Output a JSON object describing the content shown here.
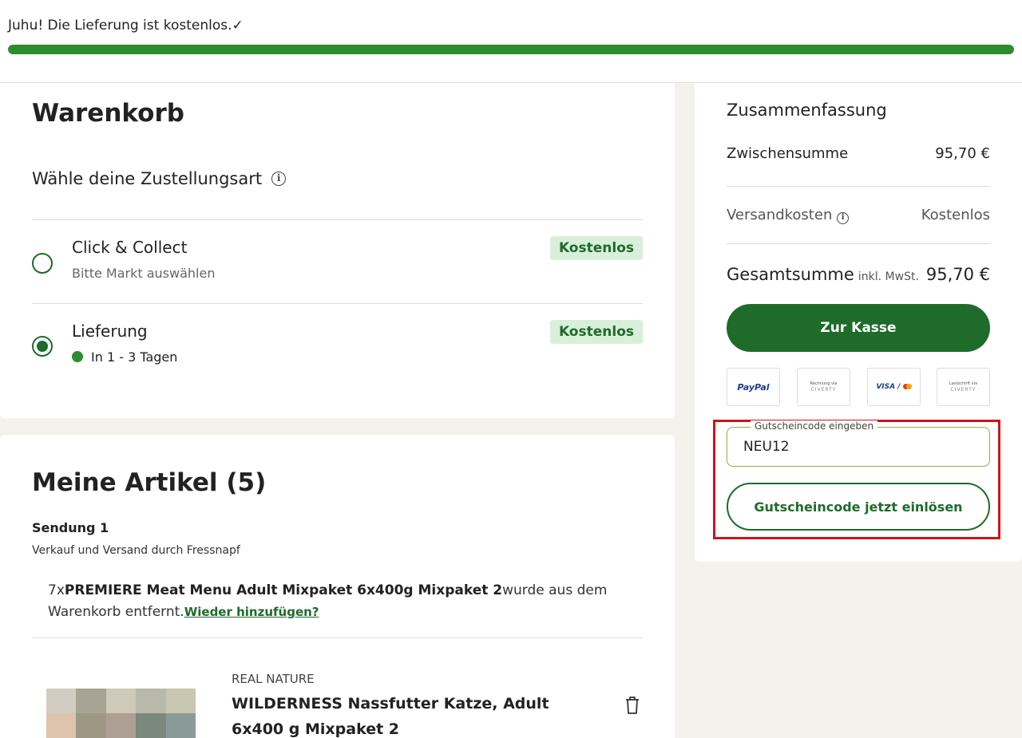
{
  "banner": {
    "message": "Juhu! Die Lieferung ist kostenlos.",
    "check": "✓",
    "progress_percent": 100,
    "progress_color": "#2d8c2d"
  },
  "cart": {
    "title": "Warenkorb",
    "delivery_heading": "Wähle deine Zustellungsart",
    "options": [
      {
        "title": "Click & Collect",
        "subtitle": "Bitte Markt auswählen",
        "badge": "Kostenlos",
        "selected": false
      },
      {
        "title": "Lieferung",
        "subtitle": "In 1 - 3 Tagen",
        "badge": "Kostenlos",
        "selected": true
      }
    ]
  },
  "articles": {
    "title": "Meine Artikel (5)",
    "shipment": "Sendung 1",
    "seller": "Verkauf und Versand durch Fressnapf",
    "removed_prefix": "7x",
    "removed_product": "PREMIERE Meat Menu Adult Mixpaket 6x400g Mixpaket 2",
    "removed_suffix": "wurde aus dem Warenkorb entfernt.",
    "readd_link": "Wieder hinzufügen?",
    "item": {
      "brand": "REAL NATURE",
      "name": "WILDERNESS Nassfutter Katze, Adult 6x400 g Mixpaket 2"
    }
  },
  "summary": {
    "title": "Zusammenfassung",
    "subtotal_label": "Zwischensumme",
    "subtotal_value": "95,70 €",
    "shipping_label": "Versandkosten",
    "shipping_value": "Kostenlos",
    "total_label": "Gesamtsumme",
    "total_note": "inkl. MwSt.",
    "total_value": "95,70 €",
    "checkout_label": "Zur Kasse",
    "payments": {
      "paypal": "PayPal",
      "rechnung_top": "Rechnung via",
      "rechnung_brand": "CIVERTY",
      "visa": "VISA /",
      "lastschrift_top": "Lastschrift via",
      "lastschrift_brand": "CIVERTY"
    },
    "coupon_label": "Gutscheincode eingeben",
    "coupon_value": "NEU12",
    "redeem_label": "Gutscheincode jetzt einlösen"
  },
  "colors": {
    "brand_green": "#1e6b2a",
    "badge_bg": "#d9efd9",
    "highlight_red": "#d0131b"
  }
}
